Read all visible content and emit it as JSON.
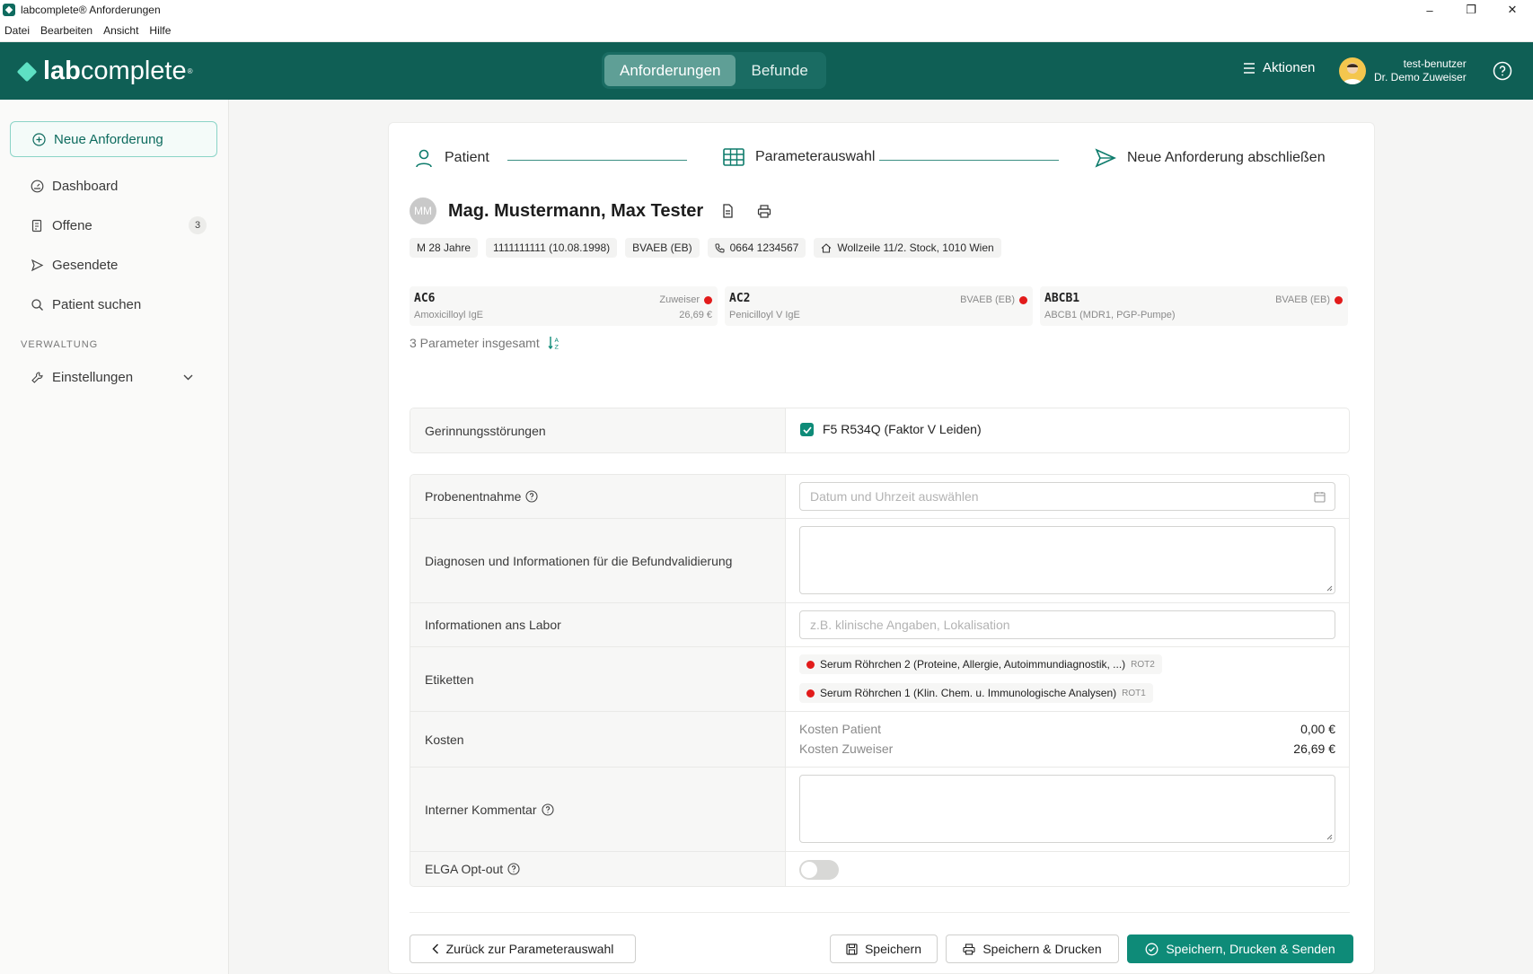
{
  "window": {
    "title": "labcomplete® Anforderungen",
    "minimize": "–",
    "restore": "❐",
    "close": "✕"
  },
  "menu": [
    "Datei",
    "Bearbeiten",
    "Ansicht",
    "Hilfe"
  ],
  "header": {
    "logo_bold": "lab",
    "logo_rest": "complete",
    "logo_mark": "®",
    "tabs": [
      {
        "label": "Anforderungen",
        "active": true
      },
      {
        "label": "Befunde",
        "active": false
      }
    ],
    "actions_label": "Aktionen",
    "user_name": "test-benutzer",
    "user_role": "Dr. Demo Zuweiser",
    "brand_color": "#0f5f55",
    "accent_color": "#0e8b78"
  },
  "sidebar": {
    "new_request": "Neue Anforderung",
    "items": [
      {
        "label": "Dashboard",
        "icon": "gauge-icon"
      },
      {
        "label": "Offene",
        "icon": "clipboard-icon",
        "count": "3"
      },
      {
        "label": "Gesendete",
        "icon": "send-icon"
      },
      {
        "label": "Patient suchen",
        "icon": "search-icon"
      }
    ],
    "section_label": "VERWALTUNG",
    "settings": "Einstellungen"
  },
  "stepper": {
    "steps": [
      "Patient",
      "Parameterauswahl",
      "Neue Anforderung abschließen"
    ]
  },
  "patient": {
    "initials": "MM",
    "name": "Mag. Mustermann, Max Tester",
    "sex_age": "M 28 Jahre",
    "svnr": "1111111111 (10.08.1998)",
    "insurance": "BVAEB (EB)",
    "phone": "0664 1234567",
    "address": "Wollzeile 11/2. Stock, 1010 Wien"
  },
  "parameters": [
    {
      "code": "AC6",
      "desc": "Amoxicilloyl IgE",
      "tag": "Zuweiser",
      "price": "26,69 €"
    },
    {
      "code": "AC2",
      "desc": "Penicilloyl V IgE",
      "tag": "BVAEB (EB)",
      "price": ""
    },
    {
      "code": "ABCB1",
      "desc": "ABCB1 (MDR1, PGP-Pumpe)",
      "tag": "BVAEB (EB)",
      "price": ""
    }
  ],
  "param_count": "3 Parameter insgesamt",
  "question": {
    "label": "Gerinnungsstörungen",
    "option": "F5 R534Q (Faktor V Leiden)",
    "checked": true
  },
  "form": {
    "probenentnahme_label": "Probenentnahme",
    "probenentnahme_placeholder": "Datum und Uhrzeit auswählen",
    "diagnosen_label": "Diagnosen und Informationen für die Befundvalidierung",
    "labor_label": "Informationen ans Labor",
    "labor_placeholder": "z.B. klinische Angaben, Lokalisation",
    "etiketten_label": "Etiketten",
    "etiketten": [
      {
        "text": "Serum Röhrchen 2 (Proteine, Allergie, Autoimmundiagnostik, ...)",
        "code": "ROT2"
      },
      {
        "text": "Serum Röhrchen 1 (Klin. Chem. u. Immunologische Analysen)",
        "code": "ROT1"
      }
    ],
    "kosten_label": "Kosten",
    "kosten_patient_label": "Kosten Patient",
    "kosten_patient_value": "0,00 €",
    "kosten_zuweiser_label": "Kosten Zuweiser",
    "kosten_zuweiser_value": "26,69 €",
    "kommentar_label": "Interner Kommentar",
    "elga_label": "ELGA Opt-out",
    "elga_on": false
  },
  "buttons": {
    "back": "Zurück zur Parameterauswahl",
    "save": "Speichern",
    "save_print": "Speichern & Drucken",
    "save_print_send": "Speichern, Drucken & Senden"
  }
}
